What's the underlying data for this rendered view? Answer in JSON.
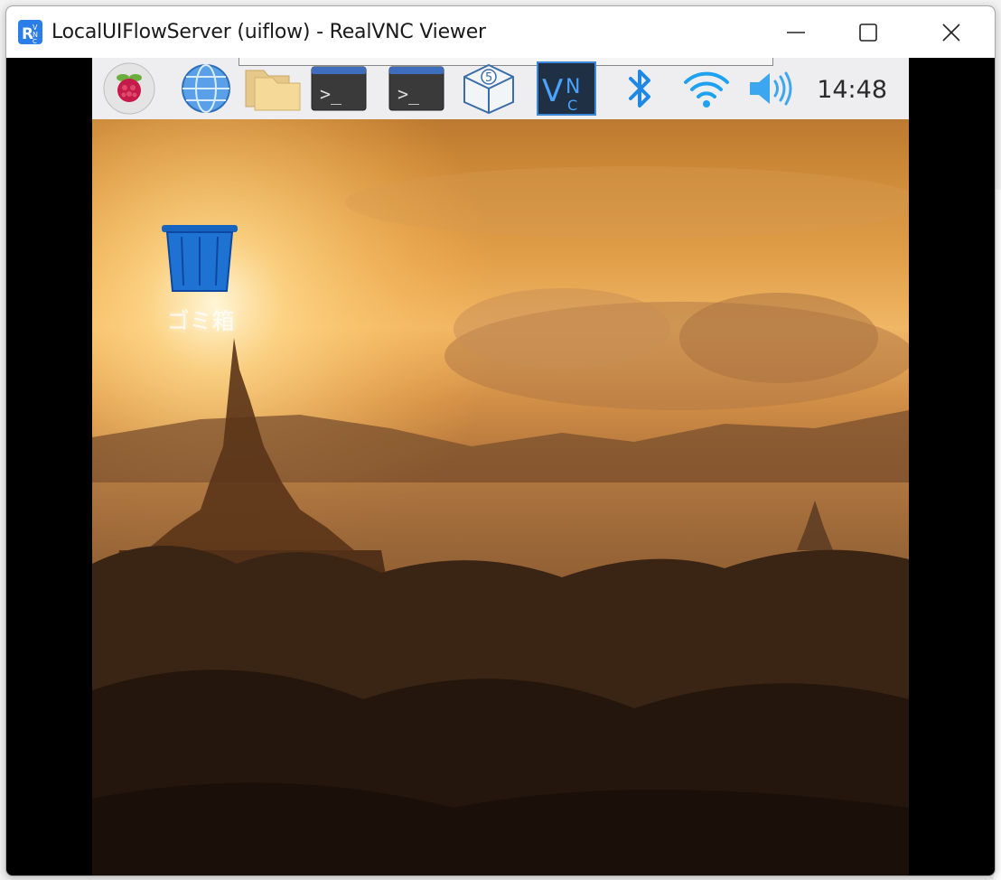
{
  "window": {
    "title": "LocalUIFlowServer (uiflow) - RealVNC Viewer",
    "app_icon": "realvnc-icon",
    "controls": [
      "minimize-icon",
      "maximize-icon",
      "close-icon"
    ]
  },
  "desktop": {
    "taskbar": {
      "launchers": [
        {
          "name": "raspberry-pi-menu-icon"
        },
        {
          "name": "web-browser-icon"
        },
        {
          "name": "file-manager-icon"
        },
        {
          "name": "terminal-icon"
        },
        {
          "name": "terminal-icon"
        },
        {
          "name": "package-box-icon"
        },
        {
          "name": "vnc-icon"
        }
      ],
      "tray": [
        "bluetooth-icon",
        "wifi-icon",
        "volume-icon"
      ],
      "clock": "14:48"
    },
    "icons": [
      {
        "name": "trash-icon",
        "label": "ゴミ箱"
      }
    ]
  },
  "colors": {
    "panel": "#eeeef0",
    "accent_blue": "#1e88e5",
    "trash_blue": "#1565c0"
  }
}
